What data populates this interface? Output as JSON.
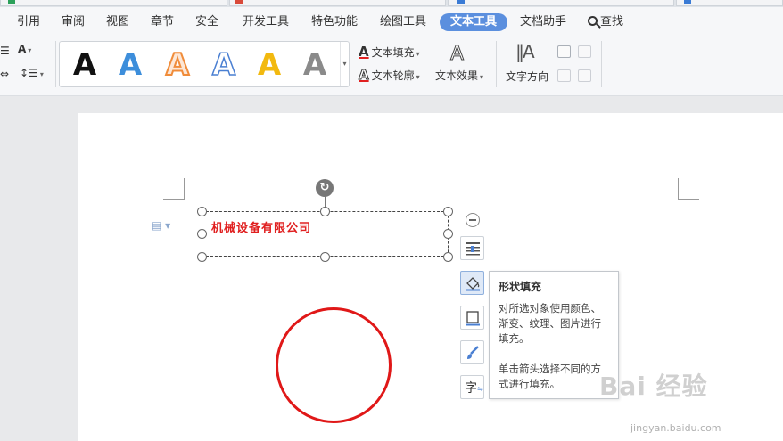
{
  "menu": {
    "items": [
      "引用",
      "审阅",
      "视图",
      "章节",
      "安全",
      "开发工具",
      "特色功能",
      "绘图工具",
      "文本工具",
      "文档助手",
      "查找"
    ],
    "active": "文本工具"
  },
  "ribbon": {
    "gallery_letter": "A",
    "gallery_colors": [
      "#111111",
      "#3d8edb",
      "#f08c3a",
      "#4a7fd2",
      "#f2b90f",
      "#777777"
    ],
    "text_fill_label": "文本填充",
    "text_outline_label": "文本轮廓",
    "text_effect_label": "文本效果",
    "text_direction_label": "文字方向",
    "accent_color": "#5b8fde"
  },
  "document": {
    "textbox_text": "机械设备有限公司",
    "text_color": "#e02020",
    "circle_color": "#e01818"
  },
  "tooltip": {
    "title": "形状填充",
    "body1": "对所选对象使用颜色、渐变、纹理、图片进行填充。",
    "body2": "单击箭头选择不同的方式进行填充。"
  },
  "side_toolbar": {
    "text_wrap_glyph": "字"
  },
  "watermark": {
    "logo": "Bai 经验",
    "url": "jingyan.baidu.com"
  }
}
